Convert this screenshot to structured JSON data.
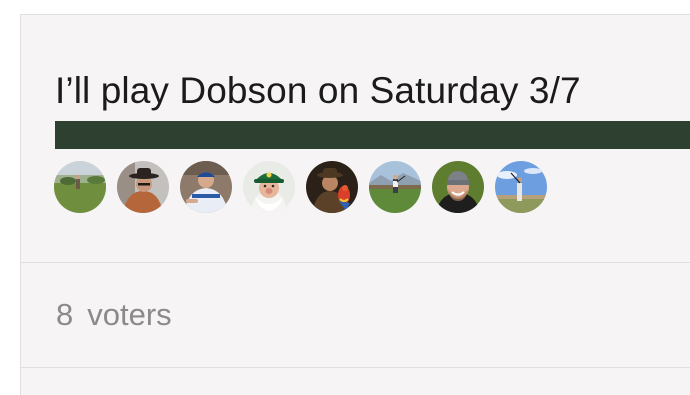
{
  "poll": {
    "option": {
      "title": "I’ll play Dobson on Saturday 3/7",
      "percent": 100,
      "bar_color": "#2e4130"
    },
    "voters": [
      {
        "avatar": "golfer-on-fairway-avatar"
      },
      {
        "avatar": "man-in-cowboy-hat-avatar"
      },
      {
        "avatar": "dodgers-fan-avatar"
      },
      {
        "avatar": "gnome-masters-hat-avatar"
      },
      {
        "avatar": "man-with-macaw-avatar"
      },
      {
        "avatar": "golfer-mountain-course-avatar"
      },
      {
        "avatar": "smiling-man-beanie-avatar"
      },
      {
        "avatar": "golfer-swing-blue-sky-avatar"
      }
    ],
    "voter_count": "8",
    "voter_label": "voters"
  }
}
